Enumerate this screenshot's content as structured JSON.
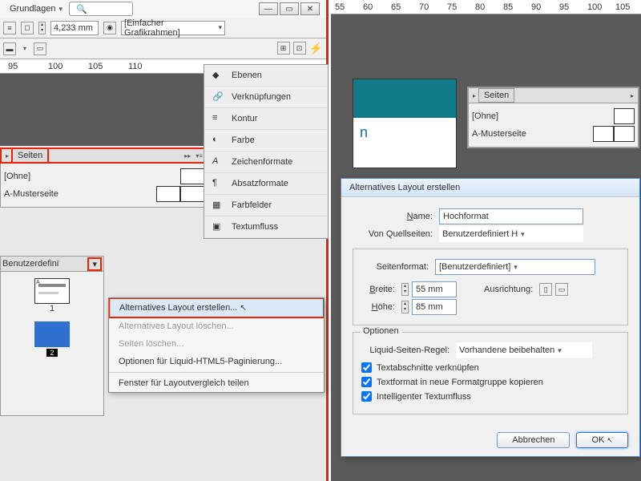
{
  "menu": {
    "grundlagen": "Grundlagen"
  },
  "toolbar": {
    "measure": "4,233 mm",
    "frame": "[Einfacher Grafikrahmen]"
  },
  "ruler_left": [
    "95",
    "100",
    "105",
    "110"
  ],
  "ruler_right": [
    "55",
    "60",
    "65",
    "70",
    "75",
    "80",
    "85",
    "90",
    "95",
    "100",
    "105"
  ],
  "seiten": {
    "tab": "Seiten",
    "ohne": "[Ohne]",
    "muster": "A-Musterseite",
    "benutzer": "Benutzerdefini",
    "p1": "1",
    "p2": "2"
  },
  "sidepanel": [
    "Ebenen",
    "Verknüpfungen",
    "Kontur",
    "Farbe",
    "Zeichenformate",
    "Absatzformate",
    "Farbfelder",
    "Textumfluss"
  ],
  "ctx": {
    "i1": "Alternatives Layout erstellen...",
    "i2": "Alternatives Layout löschen...",
    "i3": "Seiten löschen...",
    "i4": "Optionen für Liquid-HTML5-Paginierung...",
    "i5": "Fenster für Layoutvergleich teilen"
  },
  "frag": "n",
  "dlg": {
    "title": "Alternatives Layout erstellen",
    "name_l": "Name:",
    "name_v": "Hochformat",
    "quell_l": "Von Quellseiten:",
    "quell_v": "Benutzerdefiniert H",
    "format_l": "Seitenformat:",
    "format_v": "[Benutzerdefiniert]",
    "breite_l": "Breite:",
    "breite_v": "55 mm",
    "hoehe_l": "Höhe:",
    "hoehe_v": "85 mm",
    "ausr": "Ausrichtung:",
    "opt": "Optionen",
    "liquid_l": "Liquid-Seiten-Regel:",
    "liquid_v": "Vorhandene beibehalten",
    "c1": "Textabschnitte verknüpfen",
    "c2": "Textformat in neue Formatgruppe kopieren",
    "c3": "Intelligenter Textumfluss",
    "cancel": "Abbrechen",
    "ok": "OK"
  }
}
